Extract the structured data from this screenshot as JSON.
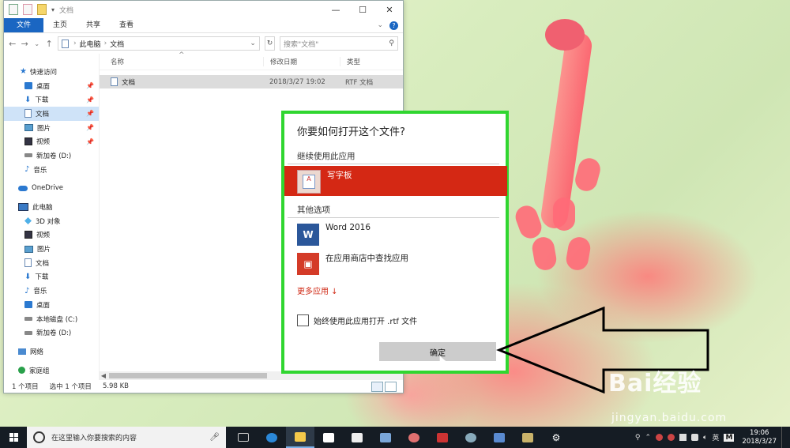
{
  "explorer": {
    "title": "文档",
    "ribbon_tabs": [
      "文件",
      "主页",
      "共享",
      "查看"
    ],
    "address": {
      "crumbs": [
        "此电脑",
        "文档"
      ]
    },
    "search_placeholder": "搜索\"文档\"",
    "columns": {
      "name": "名称",
      "modified": "修改日期",
      "type": "类型"
    },
    "files": [
      {
        "name": "文档",
        "modified": "2018/3/27 19:02",
        "type": "RTF 文档"
      }
    ],
    "sidebar": {
      "quick_access": "快速访问",
      "quick_items": [
        "桌面",
        "下载",
        "文档",
        "图片",
        "视频",
        "新加卷 (D:)",
        "音乐"
      ],
      "onedrive": "OneDrive",
      "this_pc": "此电脑",
      "pc_items": [
        "3D 对象",
        "视频",
        "图片",
        "文档",
        "下载",
        "音乐",
        "桌面",
        "本地磁盘 (C:)",
        "新加卷 (D:)"
      ],
      "network": "网络",
      "homegroup": "家庭组"
    },
    "status": {
      "count": "1 个项目",
      "selected": "选中 1 个项目",
      "size": "5.98 KB"
    }
  },
  "dialog": {
    "title": "你要如何打开这个文件?",
    "continue_label": "继续使用此应用",
    "current_app": "写字板",
    "other_label": "其他选项",
    "other_apps": [
      "Word 2016",
      "在应用商店中查找应用"
    ],
    "more_apps": "更多应用 ↓",
    "always_use": "始终使用此应用打开 .rtf 文件",
    "ok": "确定"
  },
  "taskbar": {
    "search_placeholder": "在这里输入你要搜索的内容",
    "ime": "英",
    "time": "19:06",
    "date": "2018/3/27"
  },
  "watermark": {
    "brand": "Bai经验",
    "url": "jingyan.baidu.com"
  },
  "colors": {
    "accent": "#1a66c2",
    "selected_app": "#d42814",
    "highlight_border": "#30d630",
    "taskbar": "#151c24"
  }
}
